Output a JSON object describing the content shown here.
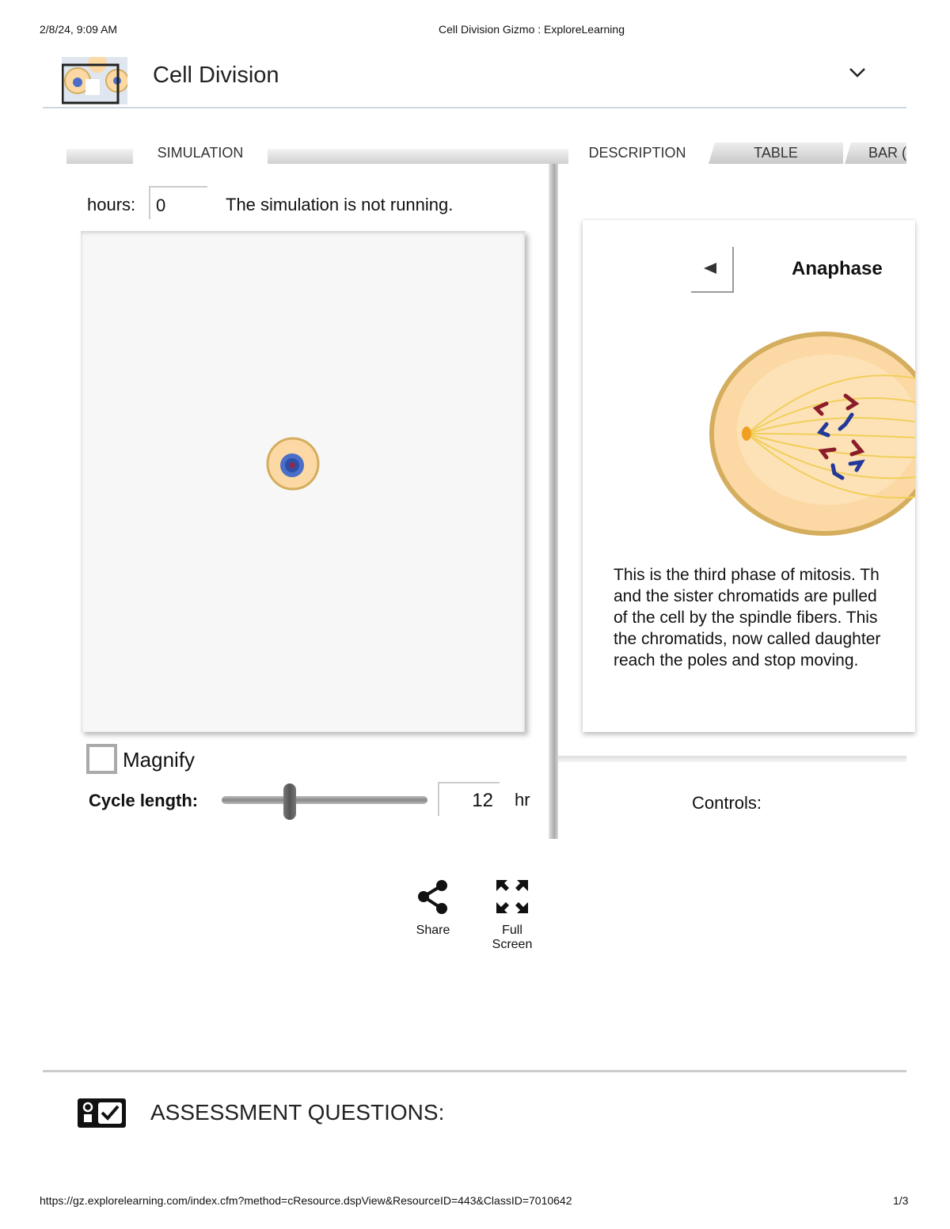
{
  "print_header": {
    "datetime": "2/8/24, 9:09 AM",
    "page_title": "Cell Division Gizmo : ExploreLearning"
  },
  "app": {
    "title": "Cell Division",
    "menu_icon": "chevron-down-icon"
  },
  "left_tabs": [
    {
      "label": "SIMULATION",
      "active": true
    }
  ],
  "right_tabs": [
    {
      "label": "DESCRIPTION",
      "active": true
    },
    {
      "label": "TABLE",
      "active": false
    },
    {
      "label": "BAR (",
      "active": false
    }
  ],
  "simulation": {
    "hours_label": "hours:",
    "hours_value": "0",
    "status": "The simulation is not running.",
    "magnify_label": "Magnify",
    "magnify_checked": false,
    "cycle_label": "Cycle length:",
    "cycle_value": "12",
    "cycle_unit": "hr"
  },
  "description": {
    "phase": "Anaphase",
    "lines": [
      "This is the third phase of mitosis. Th",
      "and the sister chromatids are pulled",
      "of the cell by the spindle fibers. This",
      "the chromatids, now called daughter",
      "reach the poles and stop moving."
    ],
    "controls_label": "Controls:"
  },
  "actions": {
    "share": "Share",
    "fullscreen_1": "Full",
    "fullscreen_2": "Screen"
  },
  "assessment": {
    "title": "ASSESSMENT QUESTIONS:"
  },
  "print_footer": {
    "url": "https://gz.explorelearning.com/index.cfm?method=cResource.dspView&ResourceID=443&ClassID=7010642",
    "page": "1/3"
  },
  "colors": {
    "chromosome_red": "#8b1c2a",
    "chromosome_blue": "#23399a",
    "cell_fill": "#fcd9a4",
    "cell_border": "#d4ad5e"
  }
}
